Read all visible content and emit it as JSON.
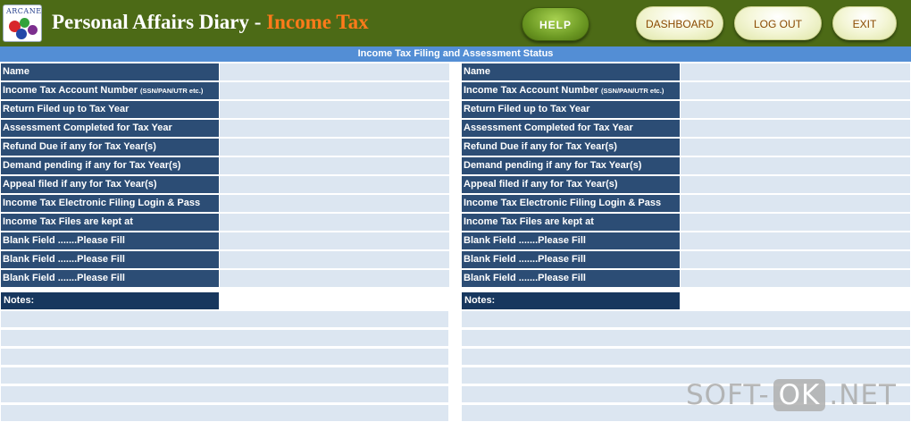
{
  "header": {
    "logo_text": "ARCANE",
    "title_main": "Personal Affairs Diary - ",
    "title_accent": "Income Tax",
    "buttons": {
      "help": "HELP",
      "dashboard": "DASHBOARD",
      "logout": "LOG OUT",
      "exit": "EXIT"
    }
  },
  "section_title": "Income Tax Filing and Assessment Status",
  "form": {
    "fields": [
      {
        "label": "Name",
        "suffix": ""
      },
      {
        "label": "Income Tax Account Number ",
        "suffix": "(SSN/PAN/UTR etc.)"
      },
      {
        "label": "Return Filed up to Tax Year",
        "suffix": ""
      },
      {
        "label": "Assessment Completed for Tax Year",
        "suffix": ""
      },
      {
        "label": "Refund Due if any for Tax Year(s)",
        "suffix": ""
      },
      {
        "label": "Demand pending if any for Tax Year(s)",
        "suffix": ""
      },
      {
        "label": "Appeal filed if any for Tax Year(s)",
        "suffix": ""
      },
      {
        "label": "Income Tax Electronic Filing  Login & Pass",
        "suffix": ""
      },
      {
        "label": "Income Tax Files are kept at",
        "suffix": ""
      },
      {
        "label": "Blank Field .......Please Fill",
        "suffix": ""
      },
      {
        "label": "Blank Field .......Please Fill",
        "suffix": ""
      },
      {
        "label": "Blank Field .......Please Fill",
        "suffix": ""
      }
    ],
    "notes_label": "Notes:",
    "notes_line_count": 6
  },
  "colors": {
    "header_bg": "#4c6a16",
    "title_accent": "#ff7a1a",
    "section_bar": "#538ed5",
    "label_bg": "#2c4d75",
    "notes_label_bg": "#17375e",
    "field_bg": "#dce6f1"
  },
  "watermark": {
    "pre": "SOFT-",
    "boxed": "OK",
    "post": ".NET"
  }
}
